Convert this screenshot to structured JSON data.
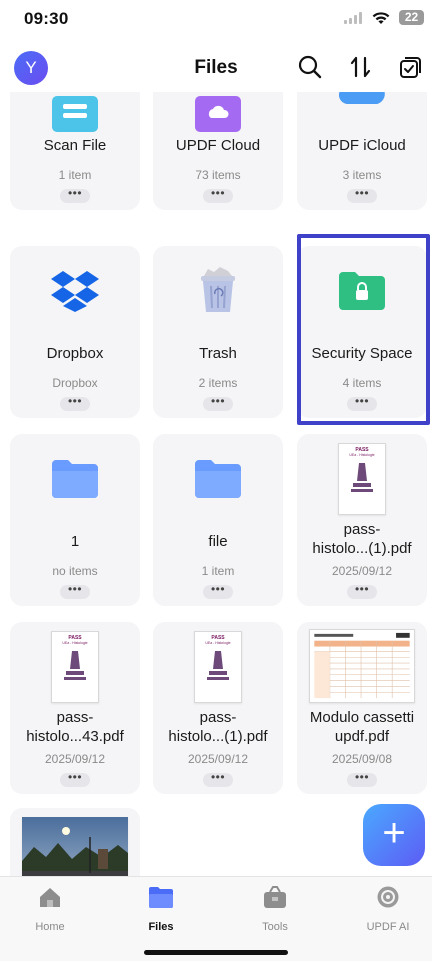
{
  "status": {
    "time": "09:30",
    "battery": "22"
  },
  "header": {
    "avatar_letter": "Y",
    "title": "Files"
  },
  "cards": [
    {
      "name": "Scan File",
      "sub": "1 item",
      "icon": "folder-scan-icon"
    },
    {
      "name": "UPDF Cloud",
      "sub": "73 items",
      "icon": "folder-cloud-icon"
    },
    {
      "name": "UPDF iCloud",
      "sub": "3 items",
      "icon": "icloud-icon"
    },
    {
      "name": "Dropbox",
      "sub": "Dropbox",
      "icon": "dropbox-icon"
    },
    {
      "name": "Trash",
      "sub": "2 items",
      "icon": "trash-icon"
    },
    {
      "name": "Security Space",
      "sub": "4 items",
      "icon": "lock-folder-icon"
    },
    {
      "name": "1",
      "sub": "no items",
      "icon": "folder-icon"
    },
    {
      "name": "file",
      "sub": "1 item",
      "icon": "folder-icon"
    },
    {
      "name": "pass-histolo...(1).pdf",
      "name_line1": "pass-",
      "name_line2": "histolo...(1).pdf",
      "sub": "2025/09/12",
      "icon": "pdf-thumbnail"
    },
    {
      "name": "pass-histolo...43.pdf",
      "name_line1": "pass-",
      "name_line2": "histolo...43.pdf",
      "sub": "2025/09/12",
      "icon": "pdf-thumbnail"
    },
    {
      "name": "pass-histolo...(1).pdf",
      "name_line1": "pass-",
      "name_line2": "histolo...(1).pdf",
      "sub": "2025/09/12",
      "icon": "pdf-thumbnail"
    },
    {
      "name": "Modulo cassetti updf.pdf",
      "name_line1": "Modulo cassetti",
      "name_line2": "updf.pdf",
      "sub": "2025/09/08",
      "icon": "spreadsheet-thumbnail"
    },
    {
      "name": "",
      "sub": "",
      "icon": "photo-thumbnail"
    }
  ],
  "more_label": "•••",
  "pdf_thumb_text": {
    "line1": "PASS",
    "line2": "UEa - Histologie"
  },
  "fab_label": "+",
  "tabs": [
    {
      "label": "Home",
      "icon": "home-icon",
      "active": false
    },
    {
      "label": "Files",
      "icon": "files-icon",
      "active": true
    },
    {
      "label": "Tools",
      "icon": "tools-icon",
      "active": false
    },
    {
      "label": "UPDF AI",
      "icon": "ai-icon",
      "active": false
    }
  ],
  "colors": {
    "accent": "#4b6cf7",
    "highlight_border": "#3f41c9",
    "folder_blue": "#6a9bff",
    "security_green": "#2fbf83"
  }
}
